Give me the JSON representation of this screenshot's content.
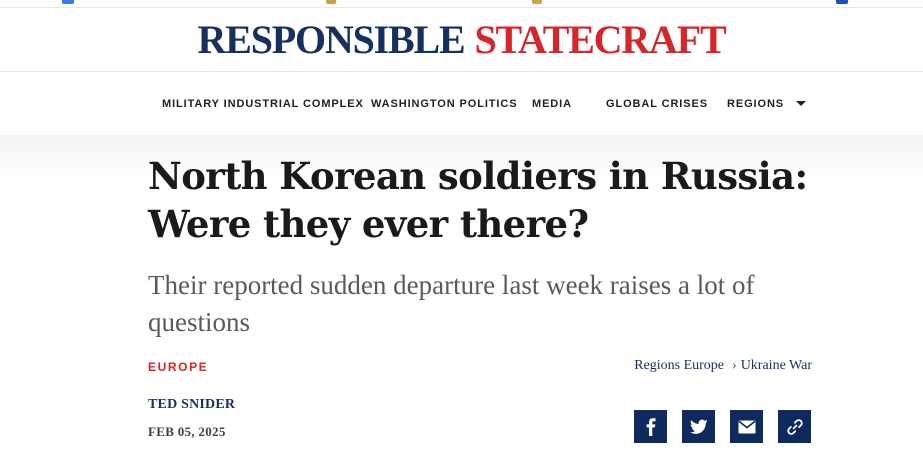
{
  "masthead": {
    "logo_word1": "RESPONSIBLE",
    "logo_word2": "STATECRAFT",
    "colors": {
      "navy": "#16315f",
      "red": "#d5262b"
    }
  },
  "nav": {
    "items": [
      {
        "label": "MILITARY INDUSTRIAL COMPLEX"
      },
      {
        "label": "WASHINGTON POLITICS"
      },
      {
        "label": "MEDIA"
      },
      {
        "label": "GLOBAL CRISES"
      },
      {
        "label": "REGIONS",
        "has_dropdown": true
      }
    ],
    "dropdown_icon": "caret-down-icon"
  },
  "article": {
    "headline": "North Korean soldiers in Russia: Were they ever there?",
    "subheadline": "Their reported sudden departure last week raises a lot of questions",
    "category": "EUROPE",
    "breadcrumbs": [
      "Regions Europe",
      "Ukraine War"
    ],
    "breadcrumb_separator": "›",
    "author": "TED SNIDER",
    "date": "FEB 05, 2025"
  },
  "share": {
    "buttons": [
      {
        "icon": "facebook-icon"
      },
      {
        "icon": "twitter-icon"
      },
      {
        "icon": "email-icon"
      },
      {
        "icon": "link-icon"
      }
    ],
    "color": "#0d2a5c"
  }
}
